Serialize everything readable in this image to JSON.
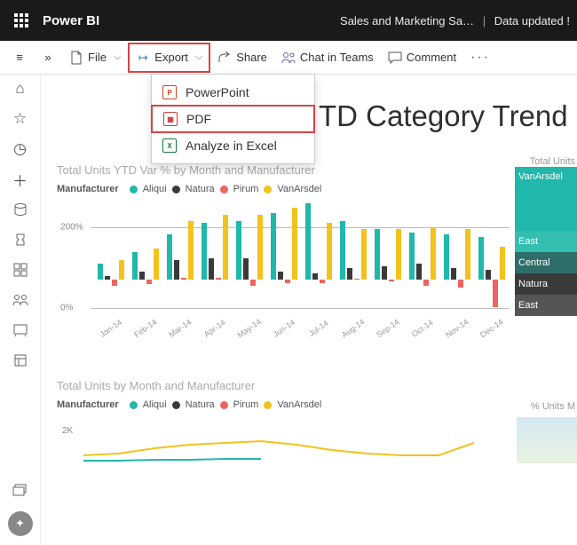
{
  "topbar": {
    "product": "Power BI",
    "report_name": "Sales and Marketing Sa…",
    "separator": "|",
    "updated": "Data updated !"
  },
  "toolbar": {
    "file": "File",
    "export": "Export",
    "share": "Share",
    "chat": "Chat in Teams",
    "comment": "Comment"
  },
  "export_menu": {
    "powerpoint": "PowerPoint",
    "pdf": "PDF",
    "excel": "Analyze in Excel"
  },
  "page_title": "TD Category Trend",
  "colors": {
    "Aliqui": "#1fb8aa",
    "Natura": "#3a3a3a",
    "Pirum": "#f0635e",
    "VanArsdel": "#f3c21c"
  },
  "legend_label": "Manufacturer",
  "manufacturers": [
    "Aliqui",
    "Natura",
    "Pirum",
    "VanArsdel"
  ],
  "chart_data": {
    "type": "bar",
    "title": "Total Units YTD Var % by Month and Manufacturer",
    "ylabel": "",
    "ylim": [
      -100,
      200
    ],
    "yticks": [
      0,
      200
    ],
    "ytick_labels": [
      "0%",
      "200%"
    ],
    "categories": [
      "Jan-14",
      "Feb-14",
      "Mar-14",
      "Apr-14",
      "May-14",
      "Jun-14",
      "Jul-14",
      "Aug-14",
      "Sep-14",
      "Oct-14",
      "Nov-14",
      "Dec-14"
    ],
    "series": [
      {
        "name": "Aliqui",
        "values": [
          40,
          70,
          115,
          145,
          150,
          170,
          195,
          150,
          130,
          120,
          115,
          110
        ]
      },
      {
        "name": "Natura",
        "values": [
          10,
          20,
          50,
          55,
          55,
          20,
          15,
          30,
          35,
          40,
          30,
          25
        ]
      },
      {
        "name": "Pirum",
        "values": [
          -15,
          -12,
          5,
          5,
          -15,
          -8,
          -10,
          2,
          -5,
          -15,
          -20,
          -70
        ]
      },
      {
        "name": "VanArsdel",
        "values": [
          50,
          80,
          150,
          165,
          165,
          185,
          145,
          130,
          130,
          135,
          130,
          85
        ]
      }
    ]
  },
  "chart2": {
    "title": "Total Units by Month and Manufacturer",
    "ytick": "2K"
  },
  "right_panel": {
    "title": "Total Units",
    "tiles": [
      {
        "label": "VanArsdel",
        "bg": "#1fb8aa",
        "tall": true
      },
      {
        "label": "East",
        "bg": "#32bfb0"
      },
      {
        "label": "Central",
        "bg": "#2d6f68"
      },
      {
        "label": "Natura",
        "bg": "#3a3a3a",
        "tall": false
      },
      {
        "label": "East",
        "bg": "#555"
      }
    ],
    "title2": "% Units M"
  }
}
